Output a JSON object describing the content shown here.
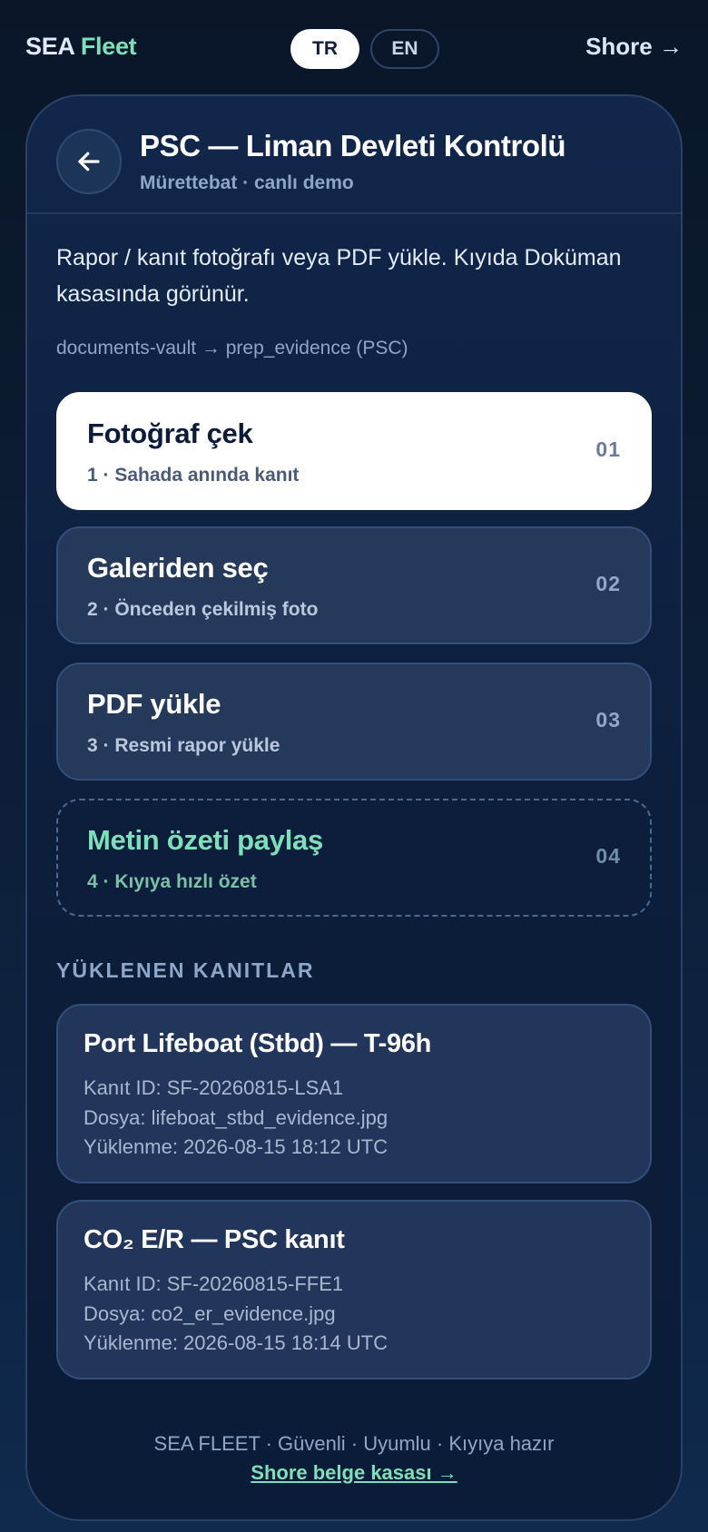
{
  "topbar": {
    "brand_part1": "SEA",
    "brand_part2": "Fleet",
    "lang_active": "TR",
    "lang_inactive": "EN",
    "shore_link": "Shore →"
  },
  "header": {
    "back_icon": "arrow-left-icon",
    "title": "PSC — Liman Devleti Kontrolü",
    "subtitle": "Mürettebat · canlı demo"
  },
  "description": "Rapor / kanıt fotoğrafı veya PDF yükle. Kıyıda Doküman kasasında görünür.",
  "path": "documents-vault → prep_evidence (PSC)",
  "options": [
    {
      "title": "Fotoğraf çek",
      "subtitle": "1 · Sahada anında kanıt",
      "number": "01"
    },
    {
      "title": "Galeriden seç",
      "subtitle": "2 · Önceden çekilmiş foto",
      "number": "02"
    },
    {
      "title": "PDF yükle",
      "subtitle": "3 · Resmi rapor yükle",
      "number": "03"
    },
    {
      "title": "Metin özeti paylaş",
      "subtitle": "4 · Kıyıya hızlı özet",
      "number": "04"
    }
  ],
  "uploads": {
    "section_title": "YÜKLENEN KANITLAR",
    "items": [
      {
        "title": "Port Lifeboat (Stbd) — T-96h",
        "id_line": "Kanıt ID: SF-20260815-LSA1",
        "file_line": "Dosya: lifeboat_stbd_evidence.jpg",
        "date_line": "Yüklenme: 2026-08-15 18:12 UTC"
      },
      {
        "title": "CO₂ E/R — PSC kanıt",
        "id_line": "Kanıt ID: SF-20260815-FFE1",
        "file_line": "Dosya: co2_er_evidence.jpg",
        "date_line": "Yüklenme: 2026-08-15 18:14 UTC"
      }
    ]
  },
  "footer": {
    "tagline": "SEA FLEET · Güvenli · Uyumlu · Kıyıya hazır",
    "link": "Shore belge kasası →"
  },
  "colors": {
    "accent_green": "#7ee0b8",
    "background": "#0d1f3a",
    "card_border": "#2a4266"
  }
}
